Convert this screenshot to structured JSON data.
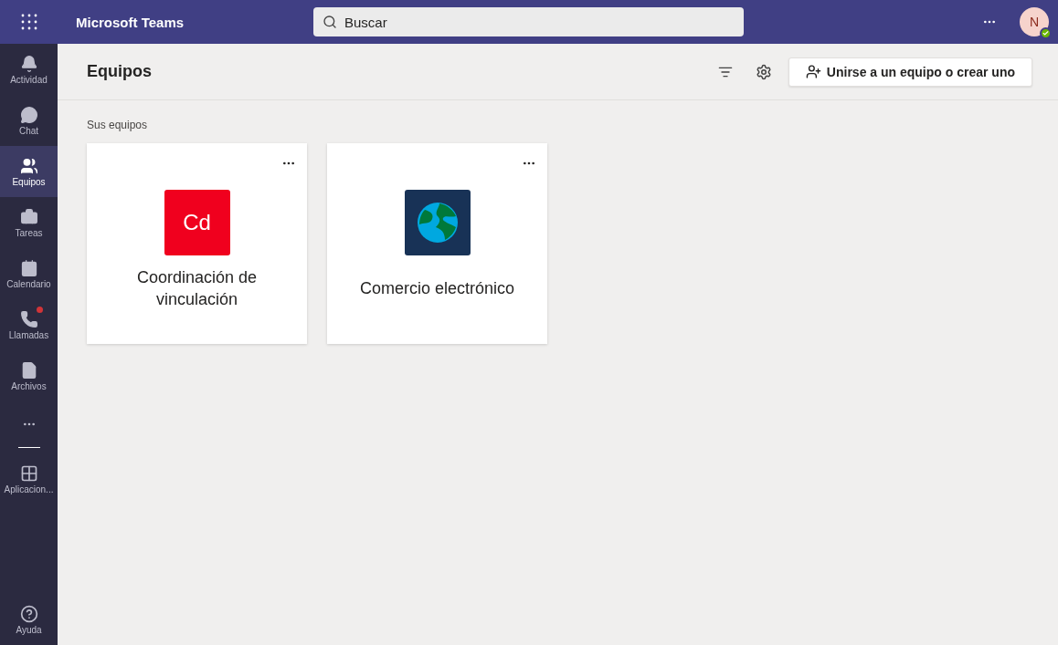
{
  "app_bar": {
    "title": "Microsoft Teams",
    "search": {
      "placeholder": "Buscar"
    },
    "avatar": {
      "initials": "N"
    }
  },
  "rail": {
    "items": [
      {
        "label": "Actividad",
        "selected": false,
        "badge": false
      },
      {
        "label": "Chat",
        "selected": false,
        "badge": false
      },
      {
        "label": "Equipos",
        "selected": true,
        "badge": false
      },
      {
        "label": "Tareas",
        "selected": false,
        "badge": false
      },
      {
        "label": "Calendario",
        "selected": false,
        "badge": false
      },
      {
        "label": "Llamadas",
        "selected": false,
        "badge": true
      },
      {
        "label": "Archivos",
        "selected": false,
        "badge": false
      }
    ],
    "apps": {
      "label": "Aplicacion..."
    },
    "help": {
      "label": "Ayuda"
    }
  },
  "header": {
    "title": "Equipos",
    "join_button": "Unirse a un equipo o crear uno"
  },
  "section": {
    "title": "Sus equipos"
  },
  "teams": [
    {
      "name": "Coordinación de vinculación",
      "kind": "initials",
      "initials": "Cd",
      "color": "#f0001e"
    },
    {
      "name": "Comercio electrónico",
      "kind": "globe",
      "color": "#183256"
    }
  ]
}
